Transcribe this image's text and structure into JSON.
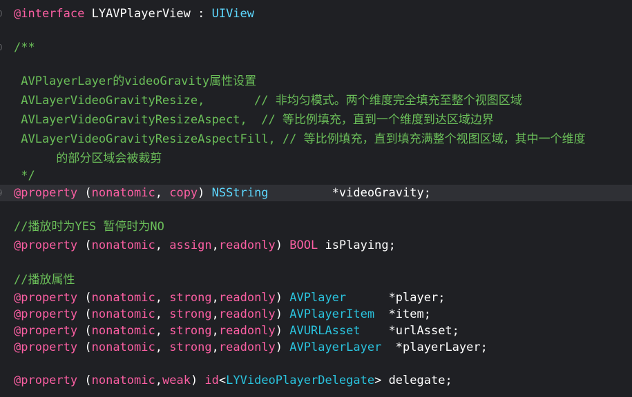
{
  "lines": [
    {
      "gutter": "0",
      "tokens": [
        {
          "cls": "tok-kw",
          "text": "@interface"
        },
        {
          "cls": "tok-plain",
          "text": " LYAVPlayerView : "
        },
        {
          "cls": "tok-type",
          "text": "UIView"
        }
      ]
    },
    {
      "gutter": "0",
      "tokens": [
        {
          "cls": "tok-comment",
          "text": "/**"
        }
      ]
    },
    {
      "gutter": "",
      "tokens": []
    },
    {
      "gutter": "",
      "tokens": [
        {
          "cls": "tok-comment",
          "text": " AVPlayerLayer的videoGravity属性设置"
        }
      ]
    },
    {
      "gutter": "",
      "tokens": [
        {
          "cls": "tok-comment",
          "text": " AVLayerVideoGravityResize,       // 非均匀模式。两个维度完全填充至整个视图区域"
        }
      ]
    },
    {
      "gutter": "",
      "tokens": [
        {
          "cls": "tok-comment",
          "text": " AVLayerVideoGravityResizeAspect,  // 等比例填充，直到一个维度到达区域边界"
        }
      ]
    },
    {
      "gutter": "",
      "tokens": [
        {
          "cls": "tok-comment",
          "text": " AVLayerVideoGravityResizeAspectFill, // 等比例填充，直到填充满整个视图区域，其中一个维度"
        }
      ]
    },
    {
      "gutter": "",
      "tokens": [
        {
          "cls": "tok-comment",
          "text": "      的部分区域会被裁剪"
        }
      ]
    },
    {
      "gutter": "",
      "tokens": [
        {
          "cls": "tok-comment",
          "text": " */"
        }
      ]
    },
    {
      "gutter": "9",
      "highlight": true,
      "tokens": [
        {
          "cls": "tok-kw",
          "text": "@property"
        },
        {
          "cls": "tok-plain",
          "text": " ("
        },
        {
          "cls": "tok-kw",
          "text": "nonatomic"
        },
        {
          "cls": "tok-plain",
          "text": ", "
        },
        {
          "cls": "tok-kw",
          "text": "copy"
        },
        {
          "cls": "tok-plain",
          "text": ") "
        },
        {
          "cls": "tok-type",
          "text": "NSString"
        },
        {
          "cls": "tok-plain",
          "text": "         *videoGravity;"
        }
      ]
    },
    {
      "gutter": "",
      "tokens": []
    },
    {
      "gutter": "",
      "tokens": [
        {
          "cls": "tok-comment",
          "text": "//播放时为YES 暂停时为NO"
        }
      ]
    },
    {
      "gutter": "",
      "tokens": [
        {
          "cls": "tok-kw",
          "text": "@property"
        },
        {
          "cls": "tok-plain",
          "text": " ("
        },
        {
          "cls": "tok-kw",
          "text": "nonatomic"
        },
        {
          "cls": "tok-plain",
          "text": ", "
        },
        {
          "cls": "tok-kw",
          "text": "assign"
        },
        {
          "cls": "tok-plain",
          "text": ","
        },
        {
          "cls": "tok-kw",
          "text": "readonly"
        },
        {
          "cls": "tok-plain",
          "text": ") "
        },
        {
          "cls": "tok-bool",
          "text": "BOOL"
        },
        {
          "cls": "tok-plain",
          "text": " isPlaying;"
        }
      ]
    },
    {
      "gutter": "",
      "tokens": []
    },
    {
      "gutter": "",
      "tokens": [
        {
          "cls": "tok-comment",
          "text": "//播放属性"
        }
      ]
    },
    {
      "gutter": "",
      "tokens": [
        {
          "cls": "tok-kw",
          "text": "@property"
        },
        {
          "cls": "tok-plain",
          "text": " ("
        },
        {
          "cls": "tok-kw",
          "text": "nonatomic"
        },
        {
          "cls": "tok-plain",
          "text": ", "
        },
        {
          "cls": "tok-kw",
          "text": "strong"
        },
        {
          "cls": "tok-plain",
          "text": ","
        },
        {
          "cls": "tok-kw",
          "text": "readonly"
        },
        {
          "cls": "tok-plain",
          "text": ") "
        },
        {
          "cls": "tok-cls",
          "text": "AVPlayer"
        },
        {
          "cls": "tok-plain",
          "text": "      *player;"
        }
      ]
    },
    {
      "gutter": "",
      "tokens": [
        {
          "cls": "tok-kw",
          "text": "@property"
        },
        {
          "cls": "tok-plain",
          "text": " ("
        },
        {
          "cls": "tok-kw",
          "text": "nonatomic"
        },
        {
          "cls": "tok-plain",
          "text": ", "
        },
        {
          "cls": "tok-kw",
          "text": "strong"
        },
        {
          "cls": "tok-plain",
          "text": ","
        },
        {
          "cls": "tok-kw",
          "text": "readonly"
        },
        {
          "cls": "tok-plain",
          "text": ") "
        },
        {
          "cls": "tok-cls",
          "text": "AVPlayerItem"
        },
        {
          "cls": "tok-plain",
          "text": "  *item;"
        }
      ]
    },
    {
      "gutter": "",
      "tokens": [
        {
          "cls": "tok-kw",
          "text": "@property"
        },
        {
          "cls": "tok-plain",
          "text": " ("
        },
        {
          "cls": "tok-kw",
          "text": "nonatomic"
        },
        {
          "cls": "tok-plain",
          "text": ", "
        },
        {
          "cls": "tok-kw",
          "text": "strong"
        },
        {
          "cls": "tok-plain",
          "text": ","
        },
        {
          "cls": "tok-kw",
          "text": "readonly"
        },
        {
          "cls": "tok-plain",
          "text": ") "
        },
        {
          "cls": "tok-cls",
          "text": "AVURLAsset"
        },
        {
          "cls": "tok-plain",
          "text": "    *urlAsset;"
        }
      ]
    },
    {
      "gutter": "",
      "tokens": [
        {
          "cls": "tok-kw",
          "text": "@property"
        },
        {
          "cls": "tok-plain",
          "text": " ("
        },
        {
          "cls": "tok-kw",
          "text": "nonatomic"
        },
        {
          "cls": "tok-plain",
          "text": ", "
        },
        {
          "cls": "tok-kw",
          "text": "strong"
        },
        {
          "cls": "tok-plain",
          "text": ","
        },
        {
          "cls": "tok-kw",
          "text": "readonly"
        },
        {
          "cls": "tok-plain",
          "text": ") "
        },
        {
          "cls": "tok-cls",
          "text": "AVPlayerLayer"
        },
        {
          "cls": "tok-plain",
          "text": "  *playerLayer;"
        }
      ]
    },
    {
      "gutter": "",
      "tokens": []
    },
    {
      "gutter": "",
      "tokens": [
        {
          "cls": "tok-kw",
          "text": "@property"
        },
        {
          "cls": "tok-plain",
          "text": " ("
        },
        {
          "cls": "tok-kw",
          "text": "nonatomic"
        },
        {
          "cls": "tok-plain",
          "text": ","
        },
        {
          "cls": "tok-kw",
          "text": "weak"
        },
        {
          "cls": "tok-plain",
          "text": ") "
        },
        {
          "cls": "tok-kw",
          "text": "id"
        },
        {
          "cls": "tok-plain",
          "text": "<"
        },
        {
          "cls": "tok-cls",
          "text": "LYVideoPlayerDelegate"
        },
        {
          "cls": "tok-plain",
          "text": "> delegate;"
        }
      ]
    }
  ]
}
